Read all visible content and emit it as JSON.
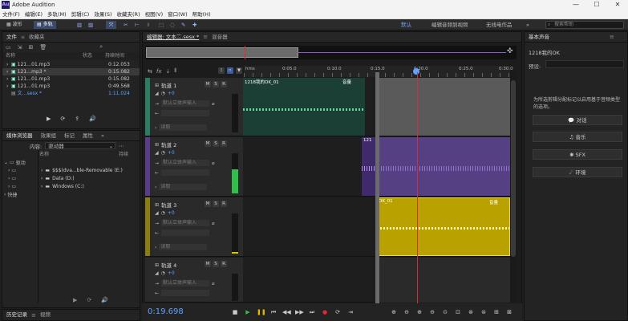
{
  "window": {
    "title": "Adobe Audition",
    "app_icon": "Au",
    "controls": [
      "—",
      "☐",
      "✕"
    ]
  },
  "menu": [
    "文件(F)",
    "编辑(E)",
    "多轨(M)",
    "剪辑(C)",
    "效果(S)",
    "收藏夹(R)",
    "视图(V)",
    "窗口(W)",
    "帮助(H)"
  ],
  "toolbar": {
    "waveform_label": "波形",
    "multitrack_label": "多轨",
    "workspaces": [
      "默认",
      "编辑音频到视频",
      "无线电作品"
    ],
    "workspace_more": "»",
    "search_placeholder": "搜索帮助"
  },
  "files_panel": {
    "tabs": [
      "文件",
      "收藏夹"
    ],
    "columns": {
      "name": "名称",
      "status": "状态",
      "duration": "持续时间"
    },
    "files": [
      {
        "name": "121…01.mp3",
        "duration": "0:12.053"
      },
      {
        "name": "121…mp3 *",
        "duration": "0:15.082"
      },
      {
        "name": "121…01.mp3",
        "duration": "0:15.082"
      },
      {
        "name": "121…01.mp3",
        "duration": "0:49.568"
      },
      {
        "name": "文…sesx *",
        "duration": "1:11.024"
      }
    ]
  },
  "media_panel": {
    "tabs": [
      "媒体浏览器",
      "效果组",
      "标记",
      "属性"
    ],
    "content_label": "内容:",
    "content_value": "驱动器",
    "col_name": "名称",
    "col_duration": "持续",
    "tree_root": "驱动",
    "tree_shortcut": "快捷",
    "drives": [
      "$$$(dva...ble-Removable (E:)",
      "Data (D:)",
      "Windows (C:)"
    ]
  },
  "history_panel": {
    "tabs": [
      "历史记录",
      "视频"
    ]
  },
  "editor": {
    "tabs": [
      "编辑器: 文本二.sesx *",
      "混音器"
    ],
    "ruler": {
      "unit": "hms",
      "ticks": [
        "0:05.0",
        "0:10.0",
        "0:15.0",
        "0:20.0",
        "0:25.0",
        "0:30.0"
      ]
    },
    "tracks": [
      {
        "name": "轨道 1",
        "volume": "+0",
        "input": "默认立体声输入",
        "mode": "读取",
        "clip": "1218我的OK_01",
        "clip_tag": "音量",
        "color": "#1a3d33"
      },
      {
        "name": "轨道 2",
        "volume": "+0",
        "input": "默认立体声输入",
        "mode": "读取",
        "clip": "121",
        "clip_tag": "",
        "color": "#3a2560"
      },
      {
        "name": "轨道 3",
        "volume": "+0",
        "input": "默认立体声输入",
        "mode": "读取",
        "clip": "OK_01",
        "clip_tag": "音量",
        "color": "#b9a200"
      },
      {
        "name": "轨道 4",
        "volume": "+0",
        "input": "默认立体声输入",
        "mode": "读取",
        "clip": "",
        "clip_tag": "",
        "color": "#1e1e1e"
      }
    ],
    "buttons": {
      "mute": "M",
      "solo": "S",
      "record": "R"
    }
  },
  "transport": {
    "timecode": "0:19.698"
  },
  "basic_sound": {
    "title": "基本声音",
    "file": "1218我的OK",
    "preset_label": "预设:",
    "hint": "为所选剪辑分配标记以启用基于音频类型的选项。",
    "types": [
      "对话",
      "音乐",
      "SFX",
      "环境"
    ]
  },
  "colors": {
    "accent_blue": "#5fa3ff",
    "playhead_red": "#e0283a",
    "track3_clip": "#b9a200",
    "track2_clip": "#3f2a6b",
    "track1_clip": "#1c3f35"
  }
}
